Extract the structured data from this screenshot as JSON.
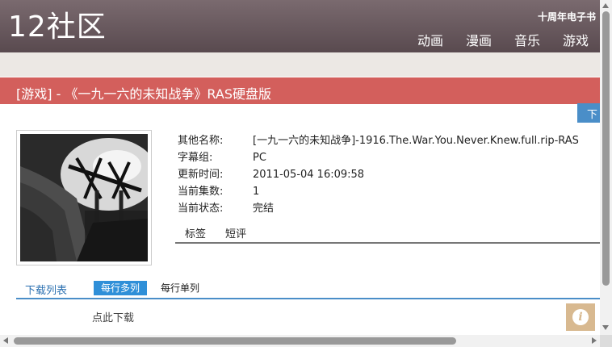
{
  "header": {
    "logo": "12社区",
    "tenyear": "十周年电子书",
    "nav": [
      "动画",
      "漫画",
      "音乐",
      "游戏"
    ]
  },
  "title": "[游戏] - 《一九一六的未知战争》RAS硬盘版",
  "download_tab": "下",
  "info": [
    {
      "label": "其他名称:",
      "value": "[一九一六的未知战争]-1916.The.War.You.Never.Knew.full.rip-RAS"
    },
    {
      "label": "字幕组:",
      "value": "PC"
    },
    {
      "label": "更新时间:",
      "value": "2011-05-04 16:09:58"
    },
    {
      "label": "当前集数:",
      "value": "1"
    },
    {
      "label": "当前状态:",
      "value": "完结"
    }
  ],
  "tabs": [
    "标签",
    "短评"
  ],
  "download_list": {
    "title": "下载列表",
    "multi": "每行多列",
    "single": "每行单列"
  },
  "click_download": "点此下载",
  "colors": {
    "title_bar": "#d35f5c",
    "accent_blue": "#2f8fd8",
    "header_bg": "#6a5a5f"
  }
}
